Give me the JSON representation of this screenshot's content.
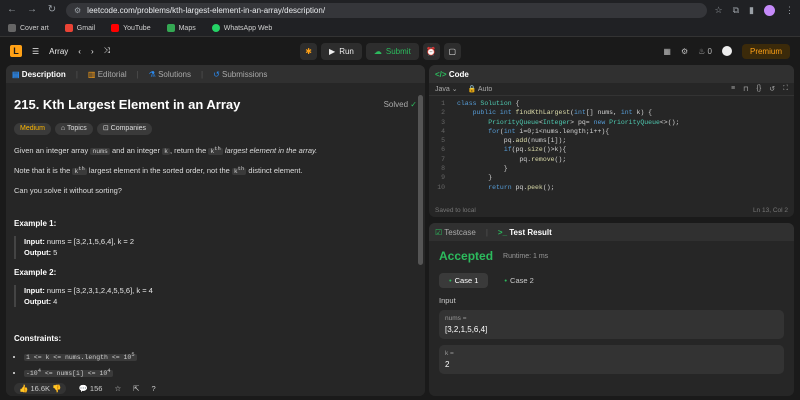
{
  "browser": {
    "url": "leetcode.com/problems/kth-largest-element-in-an-array/description/",
    "bookmarks": [
      "Cover art",
      "Gmail",
      "YouTube",
      "Maps",
      "WhatsApp Web"
    ]
  },
  "topbar": {
    "list_label": "Array",
    "run_label": "Run",
    "submit_label": "Submit",
    "streak": "0",
    "premium_label": "Premium"
  },
  "left_tabs": [
    "Description",
    "Editorial",
    "Solutions",
    "Submissions"
  ],
  "problem": {
    "title": "215. Kth Largest Element in an Array",
    "status": "Solved",
    "difficulty": "Medium",
    "topics_label": "Topics",
    "companies_label": "Companies",
    "p1_a": "Given an integer array",
    "p1_code1": "nums",
    "p1_b": "and an integer",
    "p1_code2": "k",
    "p1_c": ", return the",
    "p1_code3": "k",
    "p1_sup": "th",
    "p1_d": "largest element in the array.",
    "p2_a": "Note that it is the",
    "p2_code": "k",
    "p2_sup": "th",
    "p2_b": "largest element in the sorted order, not the",
    "p2_code2": "k",
    "p2_sup2": "th",
    "p2_c": "distinct element.",
    "p3": "Can you solve it without sorting?",
    "ex1_h": "Example 1:",
    "ex1_in_label": "Input:",
    "ex1_in": "nums = [3,2,1,5,6,4], k = 2",
    "ex1_out_label": "Output:",
    "ex1_out": "5",
    "ex2_h": "Example 2:",
    "ex2_in_label": "Input:",
    "ex2_in": "nums = [3,2,3,1,2,4,5,5,6], k = 4",
    "ex2_out_label": "Output:",
    "ex2_out": "4",
    "constraints_h": "Constraints:",
    "c1": "1 <= k <= nums.length <= 10",
    "c1_sup": "5",
    "c2": "-10",
    "c2_sup": "4",
    "c2_b": " <= nums[i] <= 10",
    "c2_sup2": "4"
  },
  "left_footer": {
    "likes": "16.6K",
    "comments": "156"
  },
  "code": {
    "tab_label": "Code",
    "language": "Java",
    "mode": "Auto",
    "saved": "Saved to local",
    "cursor": "Ln 13, Col 2",
    "line_numbers": [
      "1",
      "2",
      "3",
      "4",
      "5",
      "6",
      "7",
      "8",
      "9",
      "10"
    ]
  },
  "test": {
    "testcase_tab": "Testcase",
    "result_tab": "Test Result",
    "verdict": "Accepted",
    "runtime": "Runtime: 1 ms",
    "case1": "Case 1",
    "case2": "Case 2",
    "input_label": "Input",
    "nums_label": "nums =",
    "nums_value": "[3,2,1,5,6,4]",
    "k_label": "k =",
    "k_value": "2"
  }
}
